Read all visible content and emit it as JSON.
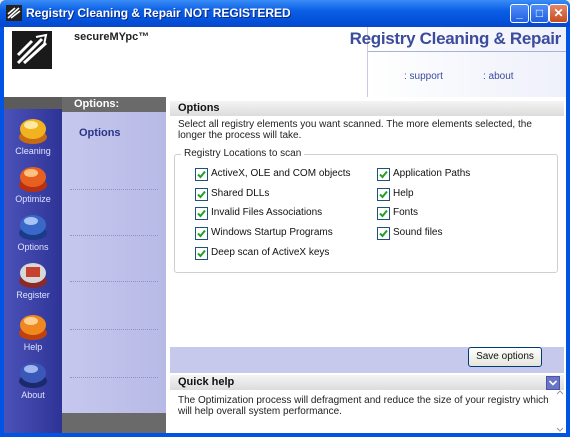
{
  "window": {
    "title": "Registry Cleaning & Repair NOT REGISTERED",
    "minimize_glyph": "_",
    "maximize_glyph": "□",
    "close_glyph": "✕"
  },
  "header": {
    "brand": "secureMYpc™",
    "app_title": "Registry Cleaning & Repair",
    "support_link": ": support",
    "about_link": ": about"
  },
  "sidebar": {
    "items": [
      {
        "label": "Cleaning",
        "icon": "cleaning-icon"
      },
      {
        "label": "Optimize",
        "icon": "optimize-icon"
      },
      {
        "label": "Options",
        "icon": "options-icon"
      },
      {
        "label": "Register",
        "icon": "register-icon"
      },
      {
        "label": "Help",
        "icon": "help-icon"
      },
      {
        "label": "About",
        "icon": "about-icon"
      }
    ]
  },
  "options_panel": {
    "heading": "Options:",
    "item": "Options"
  },
  "main": {
    "heading": "Options",
    "description": "Select all registry elements you want scanned. The more elements selected, the longer the process will take.",
    "group_title": "Registry Locations to scan",
    "left_checks": [
      {
        "label": "ActiveX, OLE and COM objects",
        "checked": true
      },
      {
        "label": "Shared DLLs",
        "checked": true
      },
      {
        "label": "Invalid Files Associations",
        "checked": true
      },
      {
        "label": "Windows Startup Programs",
        "checked": true
      },
      {
        "label": "Deep scan of ActiveX keys",
        "checked": true
      }
    ],
    "right_checks": [
      {
        "label": "Application Paths",
        "checked": true
      },
      {
        "label": "Help",
        "checked": true
      },
      {
        "label": "Fonts",
        "checked": true
      },
      {
        "label": "Sound files",
        "checked": true
      }
    ],
    "save_button": "Save options"
  },
  "quick_help": {
    "heading": "Quick help",
    "text": "The Optimization process will defragment and reduce the size of your registry which will help overall system performance."
  },
  "colors": {
    "titlebar": "#0a5fe5",
    "sidebar": "#2e3396",
    "options_panel": "#c6c8ee",
    "accent_text": "#3c4c9c"
  }
}
